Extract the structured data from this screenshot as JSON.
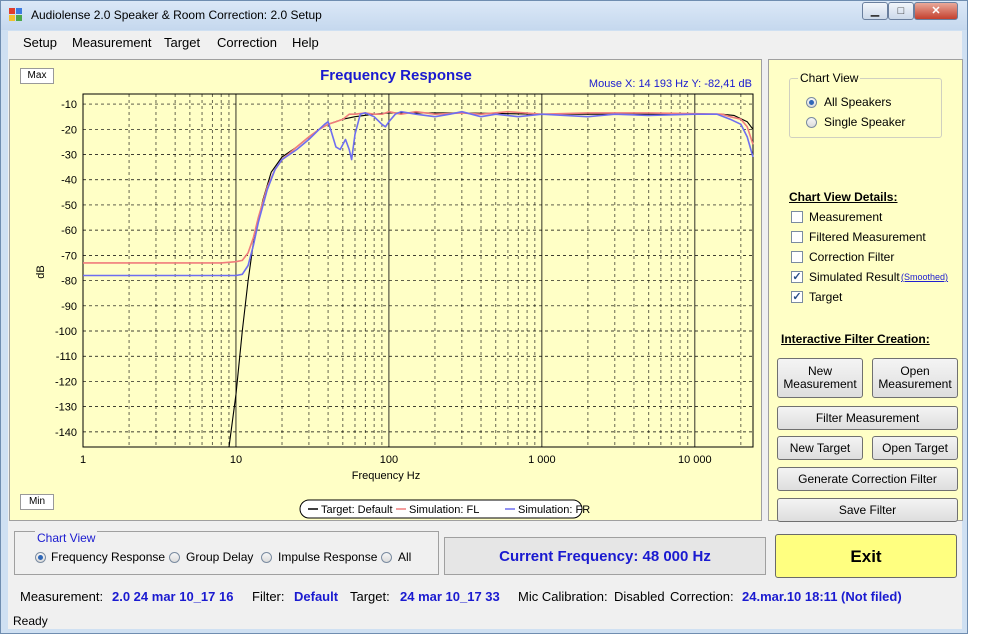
{
  "window": {
    "title": "Audiolense 2.0 Speaker & Room Correction: 2.0 Setup"
  },
  "menu": [
    "Setup",
    "Measurement",
    "Target",
    "Correction",
    "Help"
  ],
  "chart_buttons": {
    "max": "Max",
    "min": "Min"
  },
  "chart_data": {
    "type": "line",
    "title": "Frequency Response",
    "mouse_readout": "Mouse X: 14 193 Hz   Y: -82,41 dB",
    "xlabel": "Frequency Hz",
    "ylabel": "dB",
    "xscale": "log",
    "xlim": [
      1,
      24000
    ],
    "ylim": [
      -146,
      -6
    ],
    "x_ticks": [
      {
        "v": 1,
        "label": "1"
      },
      {
        "v": 10,
        "label": "10"
      },
      {
        "v": 100,
        "label": "100"
      },
      {
        "v": 1000,
        "label": "1 000"
      },
      {
        "v": 10000,
        "label": "10 000"
      }
    ],
    "y_ticks": [
      {
        "v": -10,
        "label": "-10"
      },
      {
        "v": -20,
        "label": "-20"
      },
      {
        "v": -30,
        "label": "-30"
      },
      {
        "v": -40,
        "label": "-40"
      },
      {
        "v": -50,
        "label": "-50"
      },
      {
        "v": -60,
        "label": "-60"
      },
      {
        "v": -70,
        "label": "-70"
      },
      {
        "v": -80,
        "label": "-80"
      },
      {
        "v": -90,
        "label": "-90"
      },
      {
        "v": -100,
        "label": "-100"
      },
      {
        "v": -110,
        "label": "-110"
      },
      {
        "v": -120,
        "label": "-120"
      },
      {
        "v": -130,
        "label": "-130"
      },
      {
        "v": -140,
        "label": "-140"
      }
    ],
    "grid": true,
    "legend_position": "bottom",
    "series": [
      {
        "name": "Target: Default",
        "color": "#000000",
        "points": [
          [
            9,
            -146
          ],
          [
            10,
            -125
          ],
          [
            11,
            -100
          ],
          [
            12,
            -80
          ],
          [
            13,
            -65
          ],
          [
            15,
            -48
          ],
          [
            17,
            -37
          ],
          [
            20,
            -31
          ],
          [
            25,
            -27
          ],
          [
            30,
            -23
          ],
          [
            35,
            -20
          ],
          [
            40,
            -18
          ],
          [
            50,
            -16
          ],
          [
            60,
            -15
          ],
          [
            80,
            -14
          ],
          [
            100,
            -13.5
          ],
          [
            300,
            -13.5
          ],
          [
            1000,
            -14
          ],
          [
            10000,
            -14
          ],
          [
            15000,
            -14
          ],
          [
            18000,
            -14.5
          ],
          [
            22000,
            -17
          ],
          [
            24000,
            -20
          ]
        ]
      },
      {
        "name": "Simulation: FL",
        "color": "#f07c7c",
        "points": [
          [
            1,
            -73
          ],
          [
            5,
            -73
          ],
          [
            8,
            -73
          ],
          [
            10,
            -72.5
          ],
          [
            11,
            -72
          ],
          [
            12,
            -69
          ],
          [
            13,
            -63
          ],
          [
            14,
            -55
          ],
          [
            16,
            -43
          ],
          [
            18,
            -36
          ],
          [
            20,
            -32
          ],
          [
            25,
            -27
          ],
          [
            30,
            -23
          ],
          [
            35,
            -20
          ],
          [
            40,
            -18
          ],
          [
            45,
            -17
          ],
          [
            50,
            -16
          ],
          [
            55,
            -14
          ],
          [
            60,
            -14
          ],
          [
            70,
            -13.5
          ],
          [
            80,
            -14
          ],
          [
            90,
            -14
          ],
          [
            100,
            -13
          ],
          [
            120,
            -14
          ],
          [
            150,
            -13
          ],
          [
            200,
            -14
          ],
          [
            300,
            -13.5
          ],
          [
            400,
            -14
          ],
          [
            600,
            -13
          ],
          [
            1000,
            -14
          ],
          [
            2000,
            -13.5
          ],
          [
            5000,
            -13.5
          ],
          [
            10000,
            -13.8
          ],
          [
            15000,
            -14
          ],
          [
            17000,
            -15
          ],
          [
            20000,
            -16
          ],
          [
            22000,
            -19
          ],
          [
            24000,
            -26
          ]
        ]
      },
      {
        "name": "Simulation: FR",
        "color": "#6e6ef0",
        "points": [
          [
            1,
            -78
          ],
          [
            5,
            -78
          ],
          [
            8,
            -78
          ],
          [
            10,
            -78
          ],
          [
            11,
            -77.5
          ],
          [
            12,
            -74
          ],
          [
            13,
            -66
          ],
          [
            14,
            -57
          ],
          [
            16,
            -44
          ],
          [
            18,
            -36
          ],
          [
            20,
            -32
          ],
          [
            25,
            -28
          ],
          [
            30,
            -24
          ],
          [
            35,
            -20
          ],
          [
            38,
            -18
          ],
          [
            40,
            -17
          ],
          [
            42,
            -21
          ],
          [
            45,
            -27
          ],
          [
            48,
            -28
          ],
          [
            50,
            -26
          ],
          [
            52,
            -24
          ],
          [
            55,
            -28
          ],
          [
            57,
            -32
          ],
          [
            60,
            -22
          ],
          [
            65,
            -14
          ],
          [
            70,
            -13.5
          ],
          [
            80,
            -15
          ],
          [
            90,
            -18
          ],
          [
            95,
            -19
          ],
          [
            100,
            -17
          ],
          [
            110,
            -14
          ],
          [
            120,
            -13
          ],
          [
            150,
            -14
          ],
          [
            200,
            -15
          ],
          [
            250,
            -14
          ],
          [
            300,
            -13
          ],
          [
            400,
            -15
          ],
          [
            500,
            -14
          ],
          [
            700,
            -15
          ],
          [
            1000,
            -14
          ],
          [
            2000,
            -15
          ],
          [
            3000,
            -14
          ],
          [
            5000,
            -14.5
          ],
          [
            10000,
            -14
          ],
          [
            14000,
            -14
          ],
          [
            17000,
            -16
          ],
          [
            20000,
            -18
          ],
          [
            22000,
            -23
          ],
          [
            24000,
            -31
          ]
        ]
      }
    ]
  },
  "chart_view_group": {
    "title": "Chart View",
    "options": [
      "All Speakers",
      "Single Speaker"
    ],
    "selected": "All Speakers"
  },
  "details": {
    "title": "Chart View Details:",
    "items": [
      {
        "label": "Measurement",
        "checked": false
      },
      {
        "label": "Filtered Measurement",
        "checked": false
      },
      {
        "label": "Correction Filter",
        "checked": false
      },
      {
        "label": "Simulated Result",
        "checked": true
      },
      {
        "label": "Target",
        "checked": true
      }
    ],
    "smoothed_link": "(Smoothed)"
  },
  "interactive": {
    "title": "Interactive Filter Creation:",
    "new_measurement_l1": "New",
    "new_measurement_l2": "Measurement",
    "open_measurement_l1": "Open",
    "open_measurement_l2": "Measurement",
    "filter_measurement": "Filter Measurement",
    "new_target": "New Target",
    "open_target": "Open Target",
    "generate_filter": "Generate Correction Filter",
    "save_filter": "Save Filter"
  },
  "bottom_chart_view": {
    "title": "Chart View",
    "options": [
      "Frequency Response",
      "Group Delay",
      "Impulse Response",
      "All"
    ],
    "selected": "Frequency Response"
  },
  "current_frequency": "Current Frequency: 48 000 Hz",
  "exit_button": "Exit",
  "status": {
    "measurement_label": "Measurement:",
    "measurement_value": "2.0 24 mar 10_17 16",
    "filter_label": "Filter:",
    "filter_value": "Default",
    "target_label": "Target:",
    "target_value": "24 mar 10_17 33",
    "mic_label": "Mic Calibration:",
    "mic_value": "Disabled",
    "correction_label": "Correction:",
    "correction_value": "24.mar.10 18:11 (Not filed)"
  },
  "statusbar": {
    "text": "Ready"
  },
  "colors": {
    "chart_bg": "#ffffc6",
    "exit_bg": "#ffff80",
    "accent_blue": "#1a1ad0"
  }
}
